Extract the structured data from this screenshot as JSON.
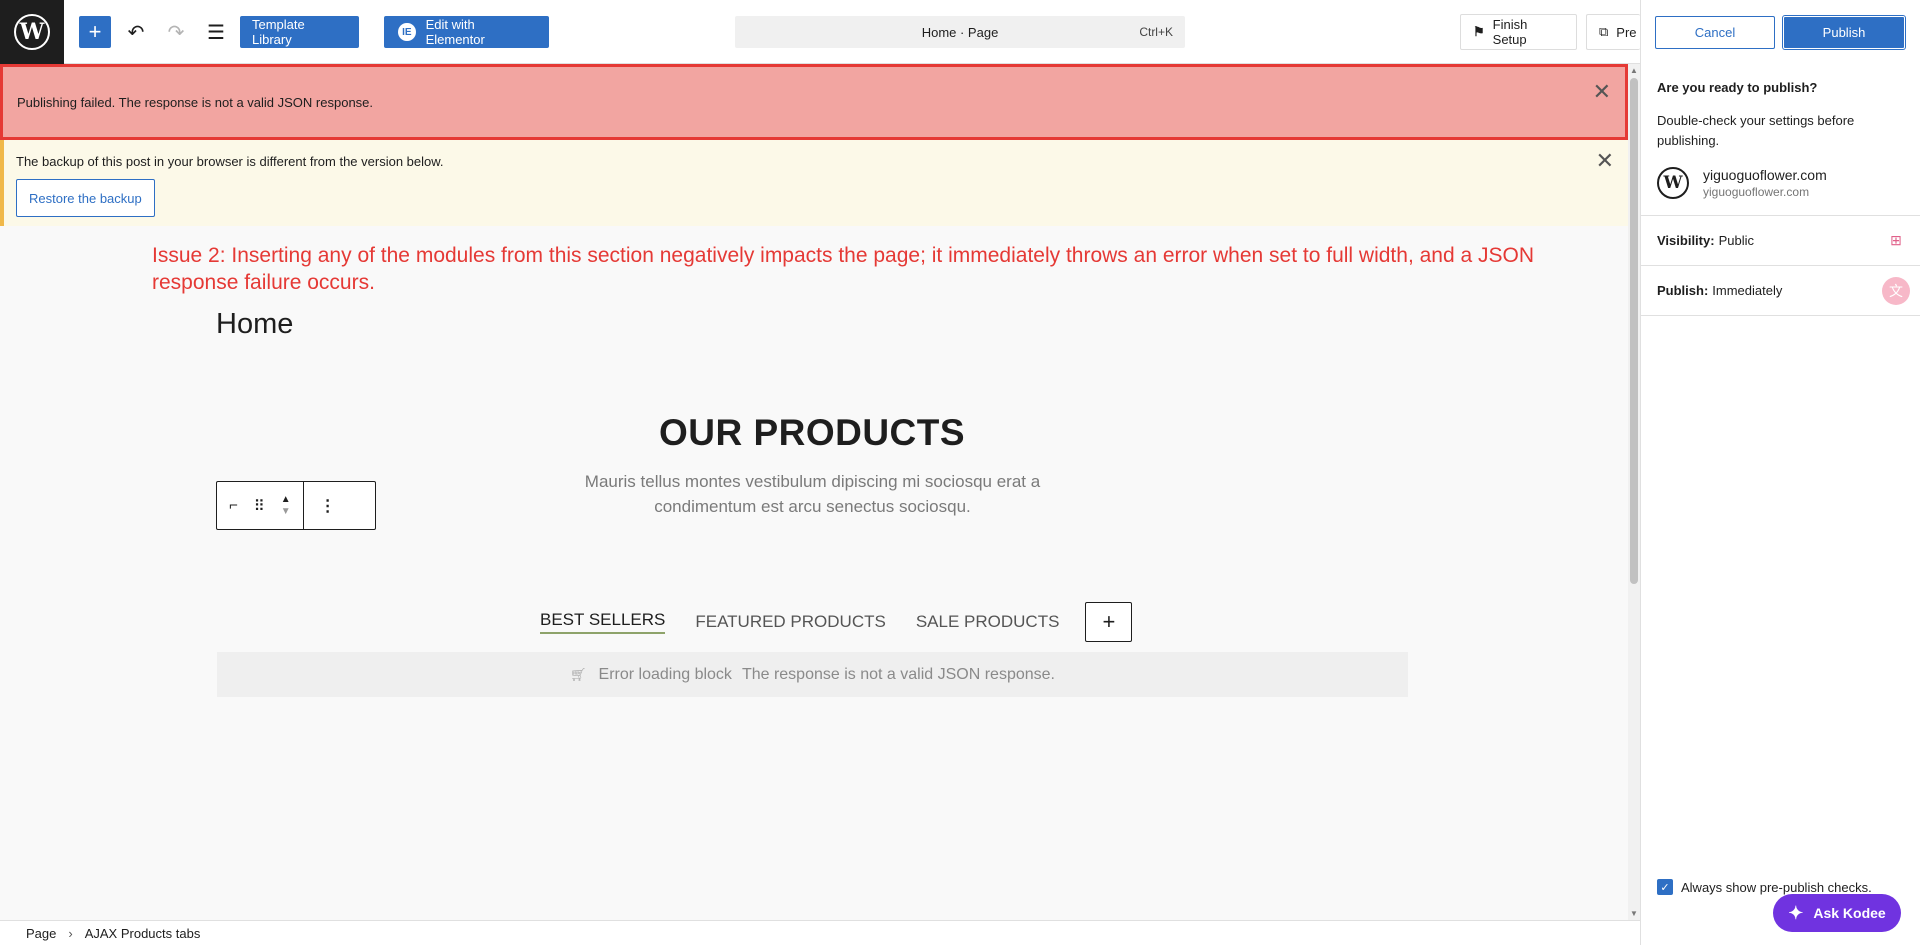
{
  "toolbar": {
    "template_library_label": "Template Library",
    "edit_elementor_label": "Edit with Elementor",
    "command_bar_title": "Home · Page",
    "command_bar_shortcut": "Ctrl+K",
    "finish_setup_label": "Finish Setup",
    "preview_label": "Pre"
  },
  "publish_panel": {
    "cancel_label": "Cancel",
    "publish_label": "Publish",
    "heading": "Are you ready to publish?",
    "description": "Double-check your settings before publishing.",
    "site_name": "yiguoguoflower.com",
    "site_url": "yiguoguoflower.com",
    "visibility_label": "Visibility:",
    "visibility_value": "Public",
    "publish_time_label": "Publish:",
    "publish_time_value": "Immediately",
    "always_show_label": "Always show pre-publish checks.",
    "always_show_checked": true,
    "ask_kodee_label": "Ask Kodee"
  },
  "notices": {
    "error_message": "Publishing failed. The response is not a valid JSON response.",
    "backup_message": "The backup of this post in your browser is different from the version below.",
    "restore_label": "Restore the backup"
  },
  "annotation": {
    "issue_text": "Issue 2: Inserting any of the modules from this section negatively impacts the page; it immediately throws an error when set to full width, and a JSON response failure occurs."
  },
  "content": {
    "page_title": "Home",
    "products_title": "OUR PRODUCTS",
    "products_subtitle": "Mauris tellus montes vestibulum dipiscing mi sociosqu erat a condimentum est arcu senectus sociosqu.",
    "tabs": [
      {
        "label": "BEST SELLERS",
        "active": true
      },
      {
        "label": "FEATURED PRODUCTS",
        "active": false
      },
      {
        "label": "SALE PRODUCTS",
        "active": false
      }
    ],
    "error_block_title": "Error loading block",
    "error_block_message": "The response is not a valid JSON response."
  },
  "breadcrumb": {
    "items": [
      "Page",
      "AJAX Products tabs"
    ],
    "separator": "›"
  },
  "colors": {
    "accent": "#2e6fc4",
    "error_bg": "#f2a5a1",
    "error_border": "#e53935",
    "warning_bg": "#fcf9e8",
    "kodee": "#7033e0"
  },
  "icons": {
    "logo": "wordpress-logo-icon",
    "add": "plus-icon",
    "undo": "undo-icon",
    "redo": "redo-icon",
    "list_view": "list-view-icon",
    "close": "close-icon",
    "cart": "cart-icon"
  }
}
